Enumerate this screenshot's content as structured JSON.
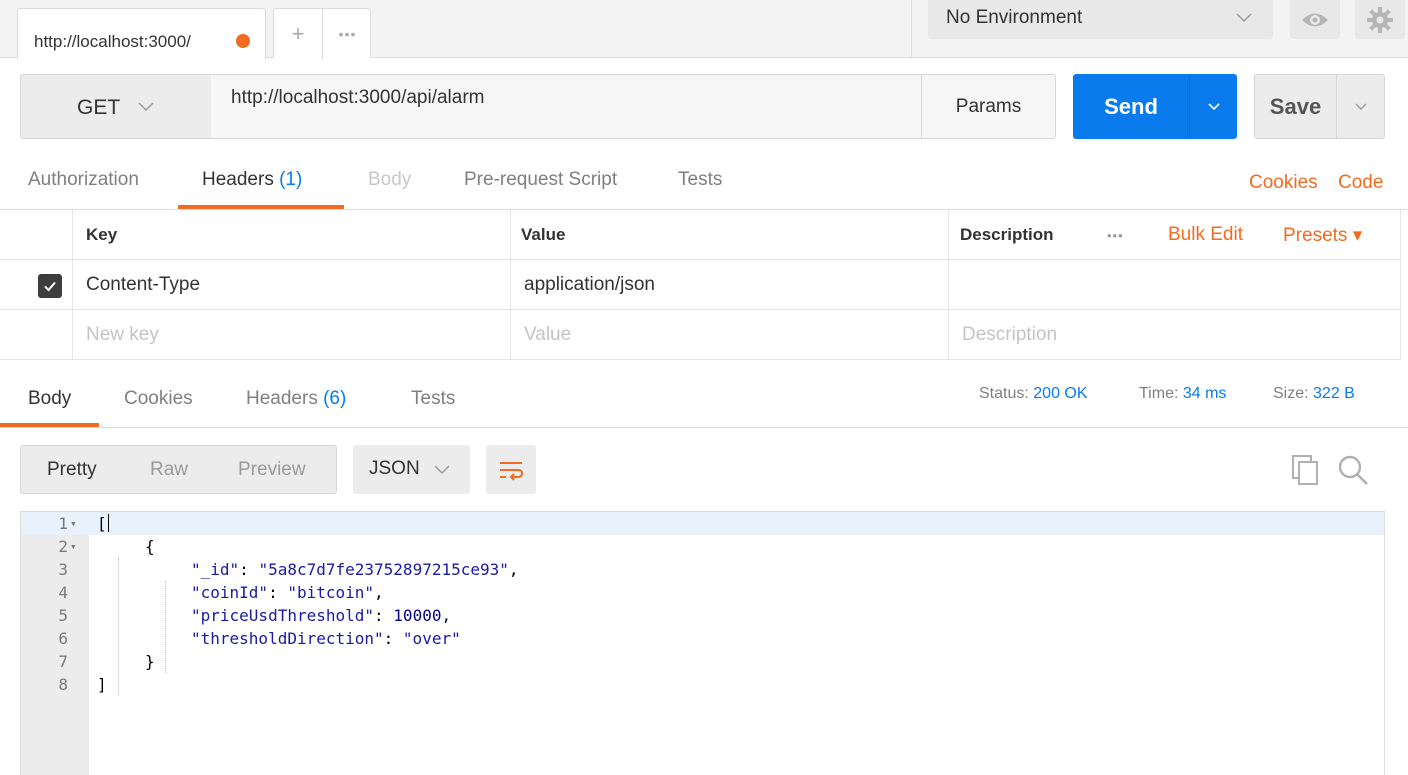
{
  "tabs": {
    "request_tab_title": "http://localhost:3000/",
    "add_symbol": "+",
    "more_symbol": "•••"
  },
  "environment": {
    "selected": "No Environment"
  },
  "request": {
    "method": "GET",
    "url": "http://localhost:3000/api/alarm",
    "params_label": "Params",
    "send_label": "Send",
    "save_label": "Save"
  },
  "request_tabs": {
    "authorization": "Authorization",
    "headers": "Headers",
    "headers_count": "(1)",
    "body": "Body",
    "pre_request": "Pre-request Script",
    "tests": "Tests",
    "cookies_link": "Cookies",
    "code_link": "Code"
  },
  "headers_table": {
    "columns": {
      "key": "Key",
      "value": "Value",
      "description": "Description"
    },
    "more_symbol": "•••",
    "bulk_edit": "Bulk Edit",
    "presets": "Presets ▾",
    "rows": [
      {
        "enabled": true,
        "key": "Content-Type",
        "value": "application/json",
        "description": ""
      }
    ],
    "new_row": {
      "key_placeholder": "New key",
      "value_placeholder": "Value",
      "description_placeholder": "Description"
    }
  },
  "response_tabs": {
    "body": "Body",
    "cookies": "Cookies",
    "headers": "Headers",
    "headers_count": "(6)",
    "tests": "Tests"
  },
  "response_status": {
    "status_label": "Status:",
    "status_value": "200 OK",
    "time_label": "Time:",
    "time_value": "34 ms",
    "size_label": "Size:",
    "size_value": "322 B"
  },
  "response_toolbar": {
    "views": [
      "Pretty",
      "Raw",
      "Preview"
    ],
    "active_view": "Pretty",
    "format": "JSON",
    "wrap_icon": "wrap-lines-icon",
    "copy_icon": "copy-icon",
    "search_icon": "search-icon"
  },
  "response_body": {
    "line_numbers": [
      "1",
      "2",
      "3",
      "4",
      "5",
      "6",
      "7",
      "8"
    ],
    "open_bracket": "[",
    "open_brace": "{",
    "fields": [
      {
        "key": "\"_id\"",
        "value": "\"5a8c7d7fe23752897215ce93\"",
        "trail": ","
      },
      {
        "key": "\"coinId\"",
        "value": "\"bitcoin\"",
        "trail": ","
      },
      {
        "key": "\"priceUsdThreshold\"",
        "value": "10000",
        "trail": ","
      },
      {
        "key": "\"thresholdDirection\"",
        "value": "\"over\"",
        "trail": ""
      }
    ],
    "close_brace": "}",
    "close_bracket": "]"
  },
  "colors": {
    "accent_orange": "#f26b21",
    "accent_blue": "#097bed"
  }
}
